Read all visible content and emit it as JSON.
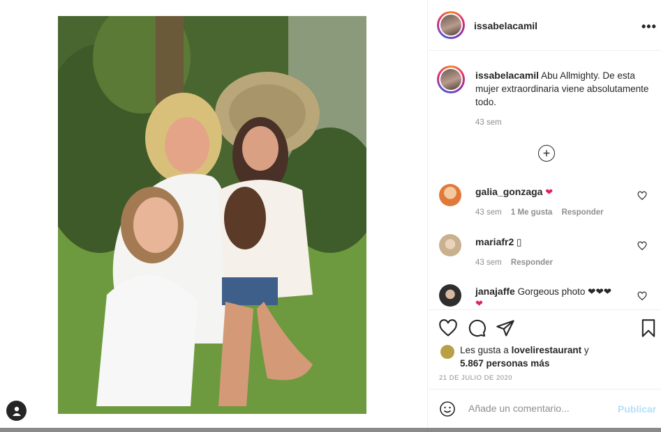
{
  "author": {
    "username": "issabelacamil"
  },
  "caption": {
    "username": "issabelacamil",
    "text": "Abu Allmighty. De esta mujer extraordinaria viene absolutamente todo.",
    "time": "43 sem"
  },
  "comments": [
    {
      "username": "galia_gonzaga",
      "text": "❤",
      "time": "43 sem",
      "likes": "1 Me gusta",
      "reply": "Responder",
      "avatar_color": "#e07a3a"
    },
    {
      "username": "mariafr2",
      "text": "▯",
      "time": "43 sem",
      "likes": "",
      "reply": "Responder",
      "avatar_color": "#c9b08e"
    },
    {
      "username": "janajaffe",
      "text": "Gorgeous photo ❤❤❤",
      "text_extra": "❤",
      "time": "",
      "likes": "",
      "reply": "",
      "avatar_color": "#2e2e2e"
    }
  ],
  "likes": {
    "prefix": "Les gusta a ",
    "user": "lovelirestaurant",
    "conj": " y",
    "others": "5.867 personas más"
  },
  "date": "21 DE JULIO DE 2020",
  "comment_bar": {
    "placeholder": "Añade un comentario...",
    "post_label": "Publicar"
  },
  "icons": {
    "more": "more-options-icon",
    "like": "heart-icon",
    "comment": "comment-icon",
    "share": "share-icon",
    "save": "bookmark-icon",
    "add": "plus-circle-icon",
    "emoji": "emoji-icon",
    "profile": "user-icon"
  },
  "colors": {
    "accent_disabled": "#b2dffc",
    "heart": "#e0245e",
    "muted": "#8e8e8e",
    "text": "#262626"
  }
}
